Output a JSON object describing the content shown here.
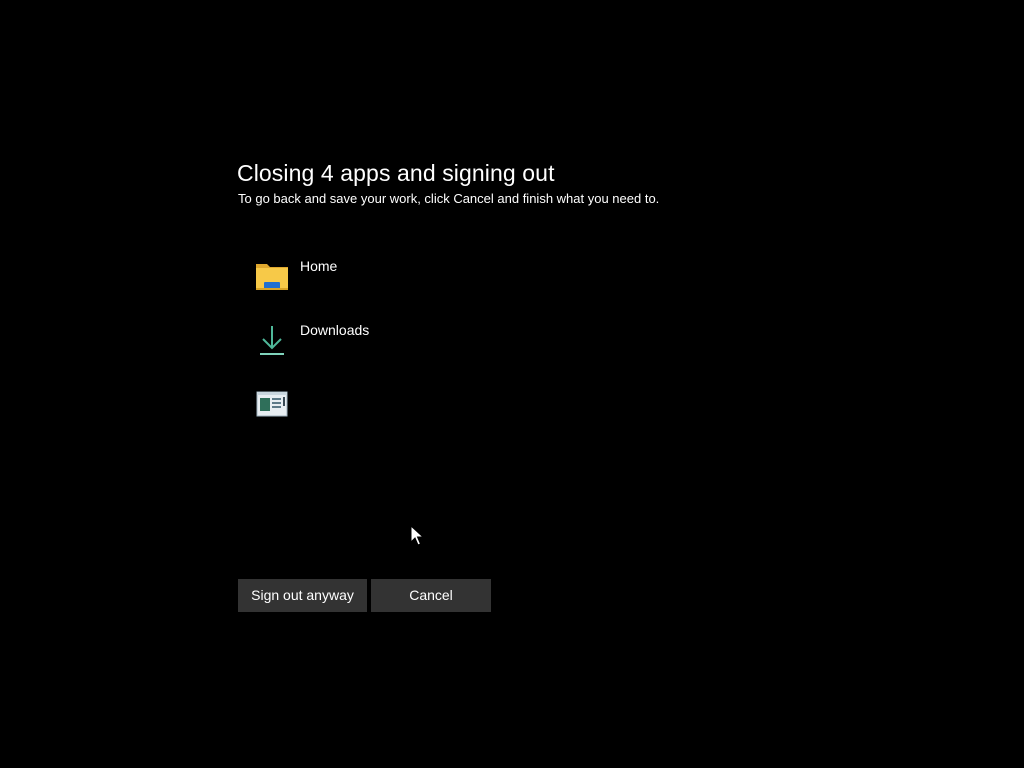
{
  "dialog": {
    "title": "Closing 4 apps and signing out",
    "subtitle": "To go back and save your work, click Cancel and finish what you need to."
  },
  "apps": [
    {
      "label": "Home",
      "icon": "folder-icon"
    },
    {
      "label": "Downloads",
      "icon": "download-icon"
    },
    {
      "label": "",
      "icon": "app-window-icon"
    }
  ],
  "buttons": {
    "sign_out_label": "Sign out anyway",
    "cancel_label": "Cancel"
  },
  "colors": {
    "background": "#000000",
    "text": "#ffffff",
    "button_bg": "#333333",
    "folder_yellow": "#f7c948",
    "download_green": "#4fb89a"
  }
}
